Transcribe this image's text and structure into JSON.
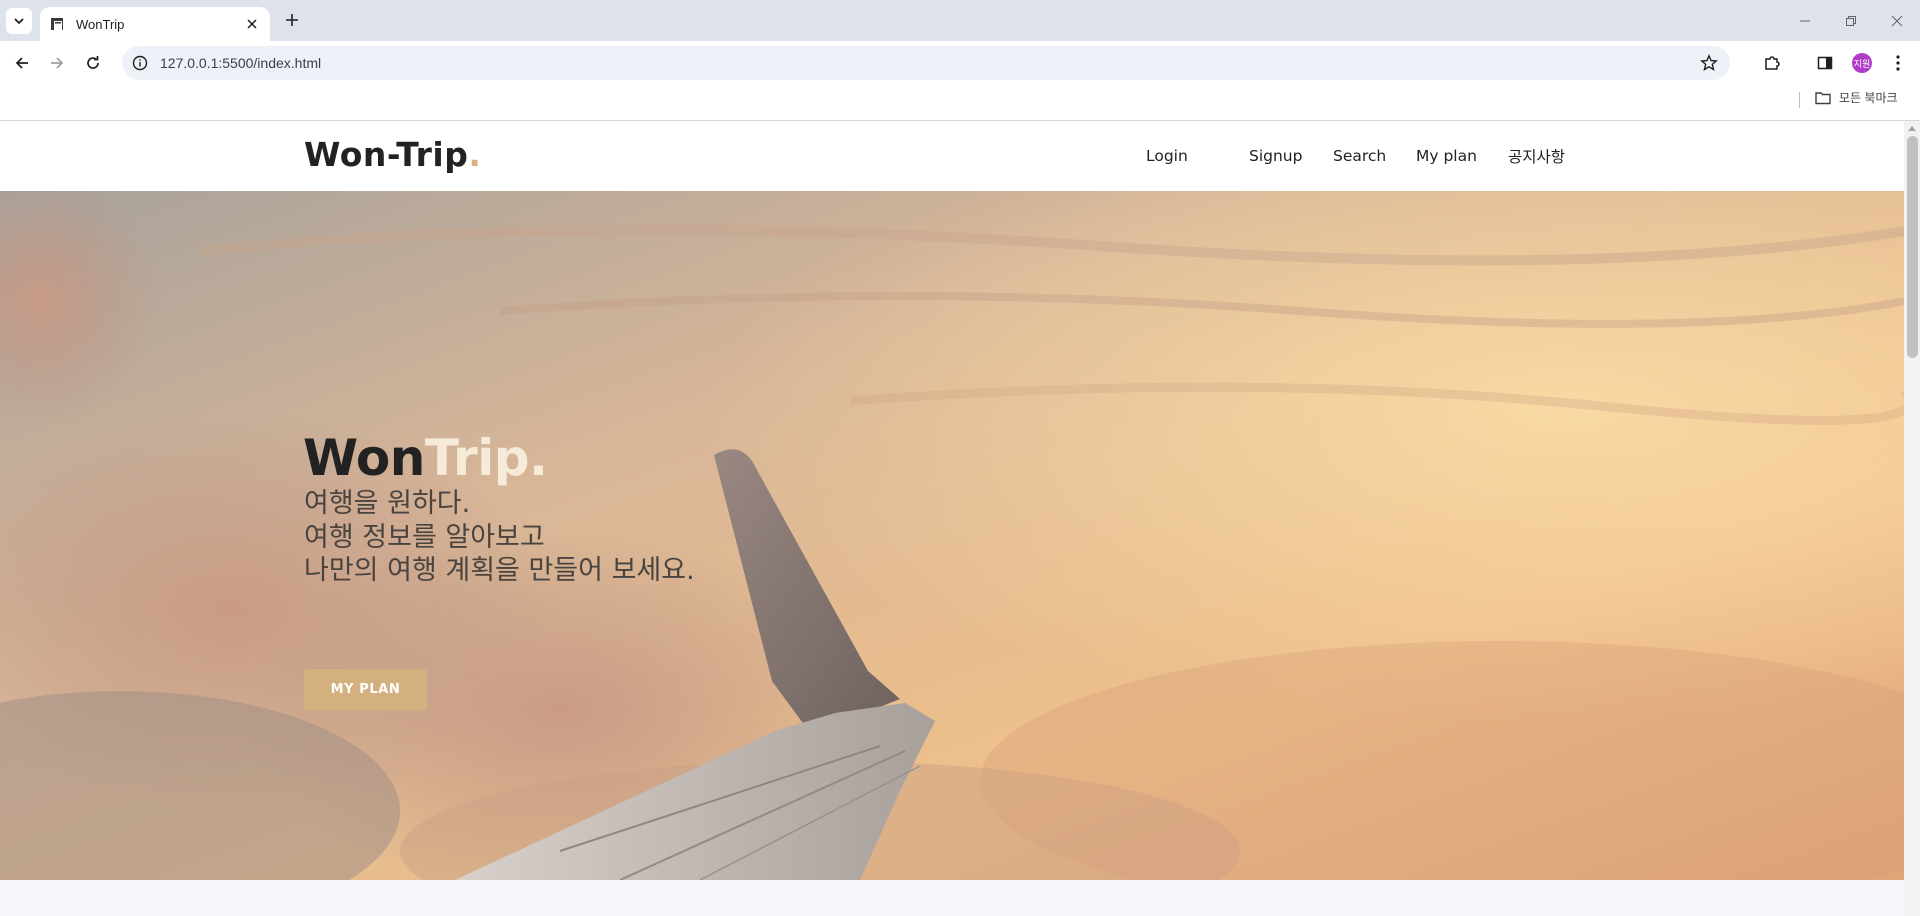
{
  "browser": {
    "tab_title": "WonTrip",
    "url": "127.0.0.1:5500/index.html",
    "profile_initials": "지원",
    "all_bookmarks": "모든 북마크",
    "colors": {
      "tabstrip": "#dee3eb",
      "omnibox": "#eef1f8",
      "profile": "#b13cc9"
    }
  },
  "site": {
    "brand_main": "Won-Trip",
    "brand_dot": ".",
    "nav": [
      {
        "label": "Login"
      },
      {
        "label": "Signup"
      },
      {
        "label": "Search"
      },
      {
        "label": "My plan"
      },
      {
        "label": "공지사항"
      }
    ],
    "hero": {
      "title_dark": "Won",
      "title_light": "Trip.",
      "lines": [
        "여행을 원하다.",
        "여행 정보를 알아보고",
        "나만의 여행 계획을 만들어 보세요."
      ],
      "button": "MY PLAN"
    },
    "colors": {
      "accent": "#d4b07f",
      "title_light": "#f6ead9",
      "text": "#222222"
    }
  }
}
